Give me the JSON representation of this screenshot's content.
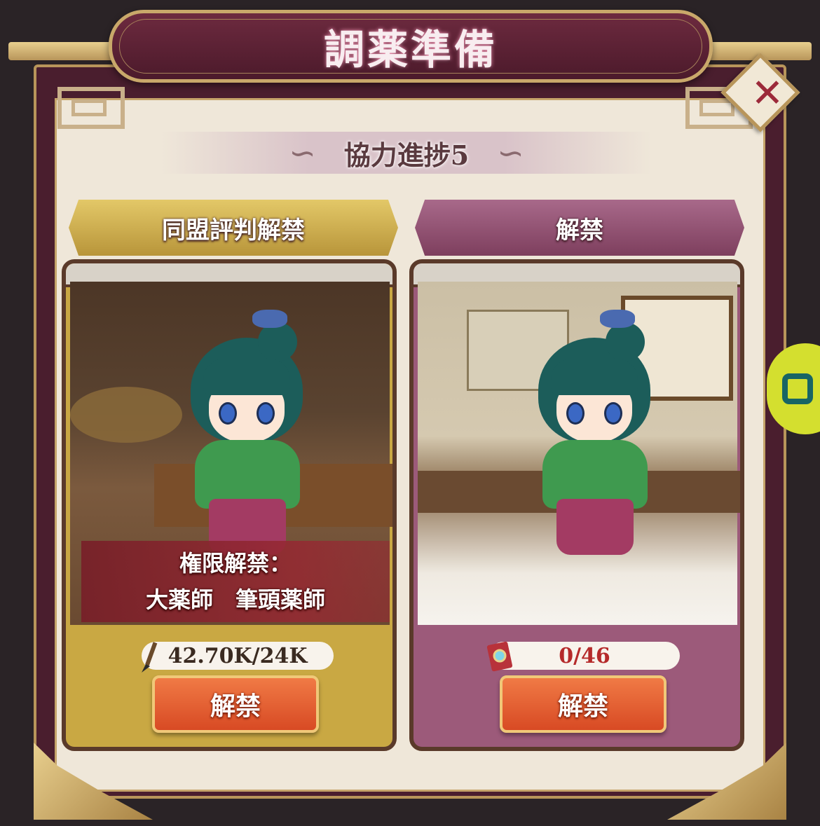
{
  "dialog": {
    "title": "調薬準備",
    "section_title": "協力進捗5"
  },
  "cards": [
    {
      "label": "同盟評判解禁",
      "unlock_info_title": "権限解禁：",
      "unlock_info_roles": "大薬師　筆頭薬師",
      "progress_text": "42.70K/24K",
      "progress_icon": "brush-icon",
      "button_label": "解禁"
    },
    {
      "label": "解禁",
      "progress_text": "0/46",
      "progress_icon": "scroll-icon",
      "button_label": "解禁"
    }
  ],
  "colors": {
    "frame": "#4a1e2e",
    "gold": "#c9a86a",
    "card_left": "#c9a843",
    "card_right": "#9c5a7a",
    "button": "#e0562c",
    "progress_red": "#b52a2a"
  }
}
